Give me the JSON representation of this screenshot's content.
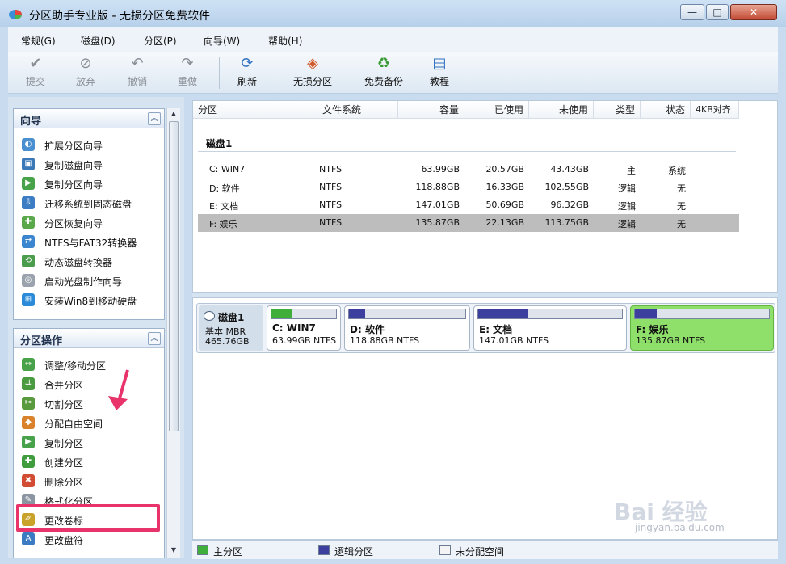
{
  "window": {
    "title": "分区助手专业版 - 无损分区免费软件",
    "controls": {
      "minimize": "—",
      "maximize": "□",
      "close": "✕"
    }
  },
  "menu": [
    {
      "label": "常规(G)"
    },
    {
      "label": "磁盘(D)"
    },
    {
      "label": "分区(P)"
    },
    {
      "label": "向导(W)"
    },
    {
      "label": "帮助(H)"
    }
  ],
  "toolbar": {
    "commit": "提交",
    "discard": "放弃",
    "undo": "撤销",
    "redo": "重做",
    "refresh": "刷新",
    "lossless": "无损分区",
    "backup": "免费备份",
    "tutorial": "教程"
  },
  "wizard_group": {
    "title": "向导",
    "items": [
      {
        "label": "扩展分区向导"
      },
      {
        "label": "复制磁盘向导"
      },
      {
        "label": "复制分区向导"
      },
      {
        "label": "迁移系统到固态磁盘"
      },
      {
        "label": "分区恢复向导"
      },
      {
        "label": "NTFS与FAT32转换器"
      },
      {
        "label": "动态磁盘转换器"
      },
      {
        "label": "启动光盘制作向导"
      },
      {
        "label": "安装Win8到移动硬盘"
      }
    ]
  },
  "ops_group": {
    "title": "分区操作",
    "items": [
      {
        "label": "调整/移动分区"
      },
      {
        "label": "合并分区"
      },
      {
        "label": "切割分区"
      },
      {
        "label": "分配自由空间"
      },
      {
        "label": "复制分区"
      },
      {
        "label": "创建分区"
      },
      {
        "label": "删除分区"
      },
      {
        "label": "格式化分区"
      },
      {
        "label": "更改卷标"
      },
      {
        "label": "更改盘符"
      }
    ]
  },
  "table": {
    "headers": {
      "partition": "分区",
      "fs": "文件系统",
      "capacity": "容量",
      "used": "已使用",
      "free": "未使用",
      "type": "类型",
      "status": "状态",
      "align": "4KB对齐"
    },
    "disk_label": "磁盘1",
    "rows": [
      {
        "partition": "C: WIN7",
        "fs": "NTFS",
        "capacity": "63.99GB",
        "used": "20.57GB",
        "free": "43.43GB",
        "type": "主",
        "status": "系统"
      },
      {
        "partition": "D: 软件",
        "fs": "NTFS",
        "capacity": "118.88GB",
        "used": "16.33GB",
        "free": "102.55GB",
        "type": "逻辑",
        "status": "无"
      },
      {
        "partition": "E: 文档",
        "fs": "NTFS",
        "capacity": "147.01GB",
        "used": "50.69GB",
        "free": "96.32GB",
        "type": "逻辑",
        "status": "无"
      },
      {
        "partition": "F: 娱乐",
        "fs": "NTFS",
        "capacity": "135.87GB",
        "used": "22.13GB",
        "free": "113.75GB",
        "type": "逻辑",
        "status": "无"
      }
    ]
  },
  "diskmap": {
    "name": "磁盘1",
    "type": "基本 MBR",
    "size": "465.76GB",
    "parts": [
      {
        "name": "C: WIN7",
        "desc": "63.99GB NTFS",
        "used_fraction": 0.32,
        "color": "#3fae3a"
      },
      {
        "name": "D: 软件",
        "desc": "118.88GB NTFS",
        "used_fraction": 0.14,
        "color": "#3d3f9e"
      },
      {
        "name": "E: 文档",
        "desc": "147.01GB NTFS",
        "used_fraction": 0.34,
        "color": "#3d3f9e"
      },
      {
        "name": "F: 娱乐",
        "desc": "135.87GB NTFS",
        "used_fraction": 0.16,
        "color": "#3d3f9e"
      }
    ]
  },
  "legend": {
    "primary": "主分区",
    "logical": "逻辑分区",
    "unallocated": "未分配空间",
    "colors": {
      "primary": "#3fae3a",
      "logical": "#3d3f9e",
      "unallocated": "#f4f4f4"
    }
  },
  "watermark": {
    "brand": "Bai 经验",
    "url": "jingyan.baidu.com"
  }
}
